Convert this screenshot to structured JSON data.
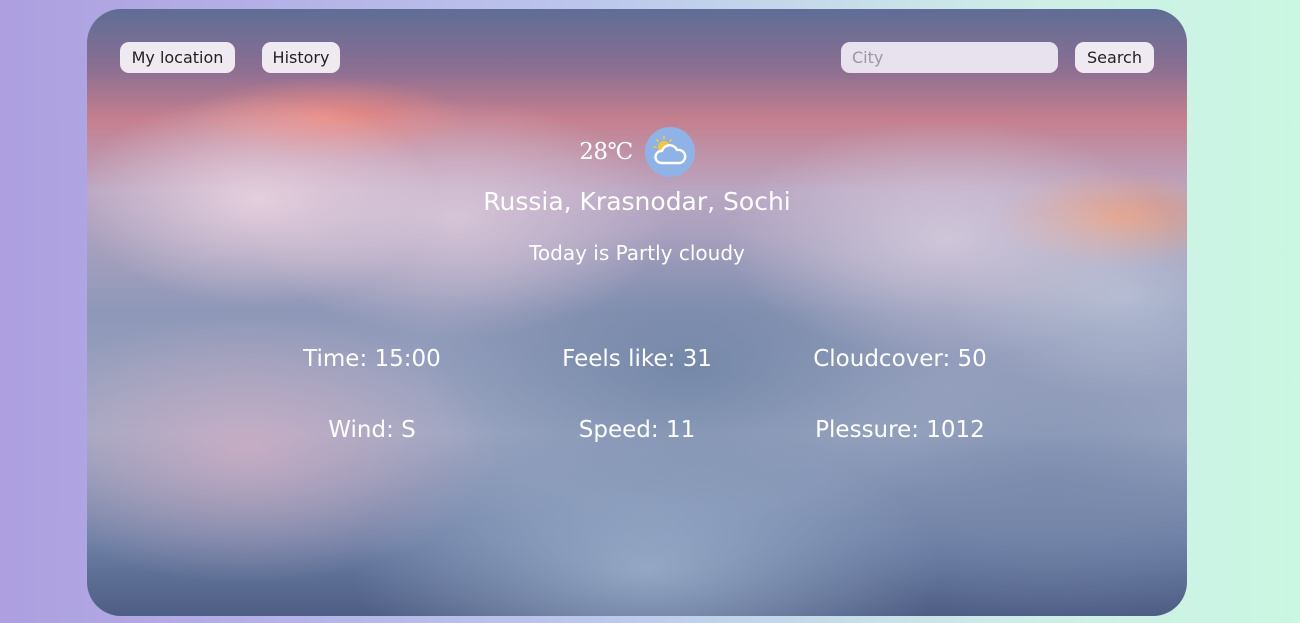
{
  "nav": {
    "my_location_label": "My location",
    "history_label": "History"
  },
  "search": {
    "placeholder": "City",
    "value": "",
    "button_label": "Search"
  },
  "weather": {
    "temperature": "28℃",
    "icon": "partly-cloudy-icon",
    "location": "Russia, Krasnodar, Sochi",
    "condition": "Today is Partly cloudy"
  },
  "details": {
    "time": "Time: 15:00",
    "feels_like": "Feels like: 31",
    "cloudcover": "Cloudcover: 50",
    "wind": "Wind: S",
    "speed": "Speed: 11",
    "pressure": "Plessure: 1012"
  },
  "colors": {
    "page_gradient_left": "#ad9fe0",
    "page_gradient_right": "#c9f7e2",
    "icon_background": "#8fb3e6",
    "sun": "#f5c542"
  }
}
